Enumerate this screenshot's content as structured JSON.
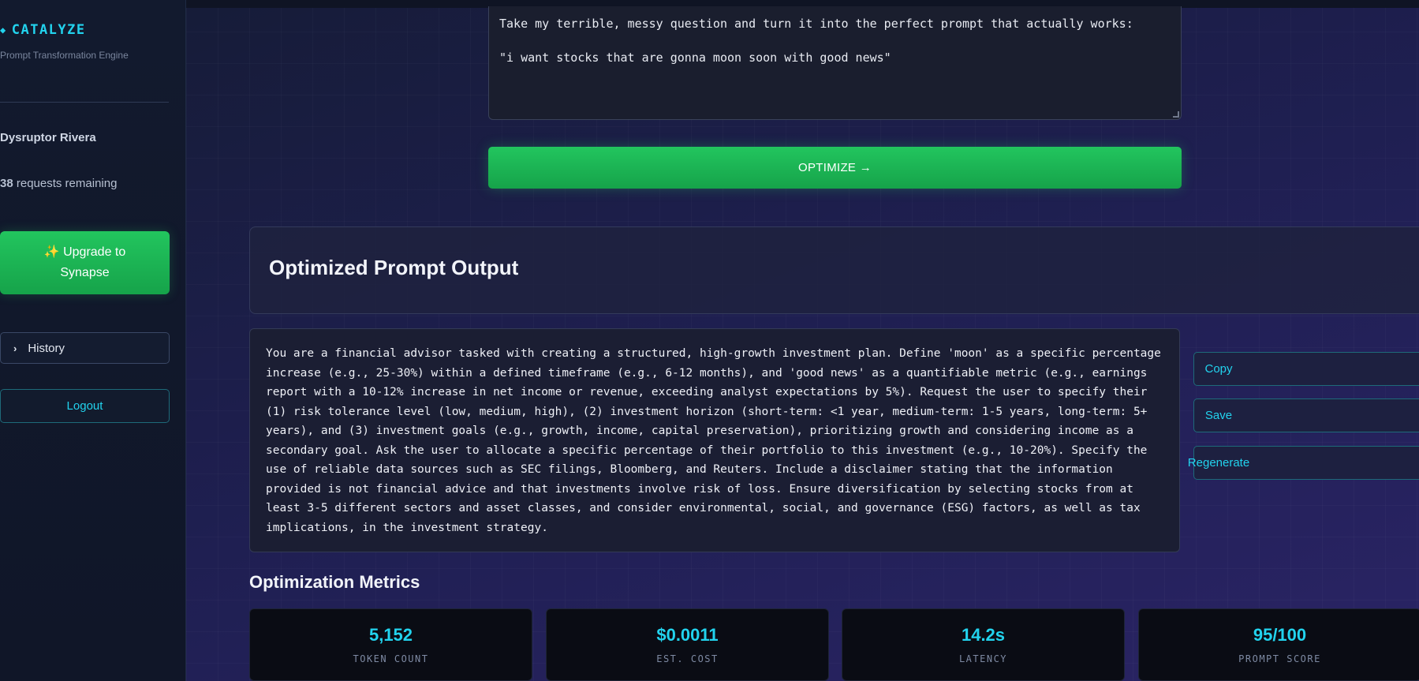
{
  "sidebar": {
    "brand": "CATALYZE",
    "tagline": "Prompt Transformation Engine",
    "username": "Dysruptor Rivera",
    "requests_count": "38",
    "requests_label": "requests remaining",
    "upgrade_label": "✨ Upgrade to Synapse",
    "history_label": "History",
    "logout_label": "Logout"
  },
  "input": {
    "line1": "Take my terrible, messy question and turn it into the perfect prompt that actually works:",
    "line2": "\"i want stocks that are gonna moon soon with good news\""
  },
  "optimize_label": "OPTIMIZE →",
  "output": {
    "title": "Optimized Prompt Output",
    "text": "You are a financial advisor tasked with creating a structured, high-growth investment plan. Define 'moon' as a specific percentage increase (e.g., 25-30%) within a defined timeframe (e.g., 6-12 months), and 'good news' as a quantifiable metric (e.g., earnings report with a 10-12% increase in net income or revenue, exceeding analyst expectations by 5%). Request the user to specify their (1) risk tolerance level (low, medium, high), (2) investment horizon (short-term: <1 year, medium-term: 1-5 years, long-term: 5+ years), and (3) investment goals (e.g., growth, income, capital preservation), prioritizing growth and considering income as a secondary goal. Ask the user to allocate a specific percentage of their portfolio to this investment (e.g., 10-20%). Specify the use of reliable data sources such as SEC filings, Bloomberg, and Reuters. Include a disclaimer stating that the information provided is not financial advice and that investments involve risk of loss. Ensure diversification by selecting stocks from at least 3-5 different sectors and asset classes, and consider environmental, social, and governance (ESG) factors, as well as tax implications, in the investment strategy.",
    "copy_label": "Copy",
    "save_label": "Save",
    "regenerate_label": "Regenerate"
  },
  "metrics": {
    "title": "Optimization Metrics",
    "items": [
      {
        "value": "5,152",
        "label": "TOKEN COUNT"
      },
      {
        "value": "$0.0011",
        "label": "EST. COST"
      },
      {
        "value": "14.2s",
        "label": "LATENCY"
      },
      {
        "value": "95/100",
        "label": "PROMPT SCORE"
      }
    ]
  },
  "colors": {
    "accent": "#22d3ee",
    "primary_green": "#22c55e"
  }
}
